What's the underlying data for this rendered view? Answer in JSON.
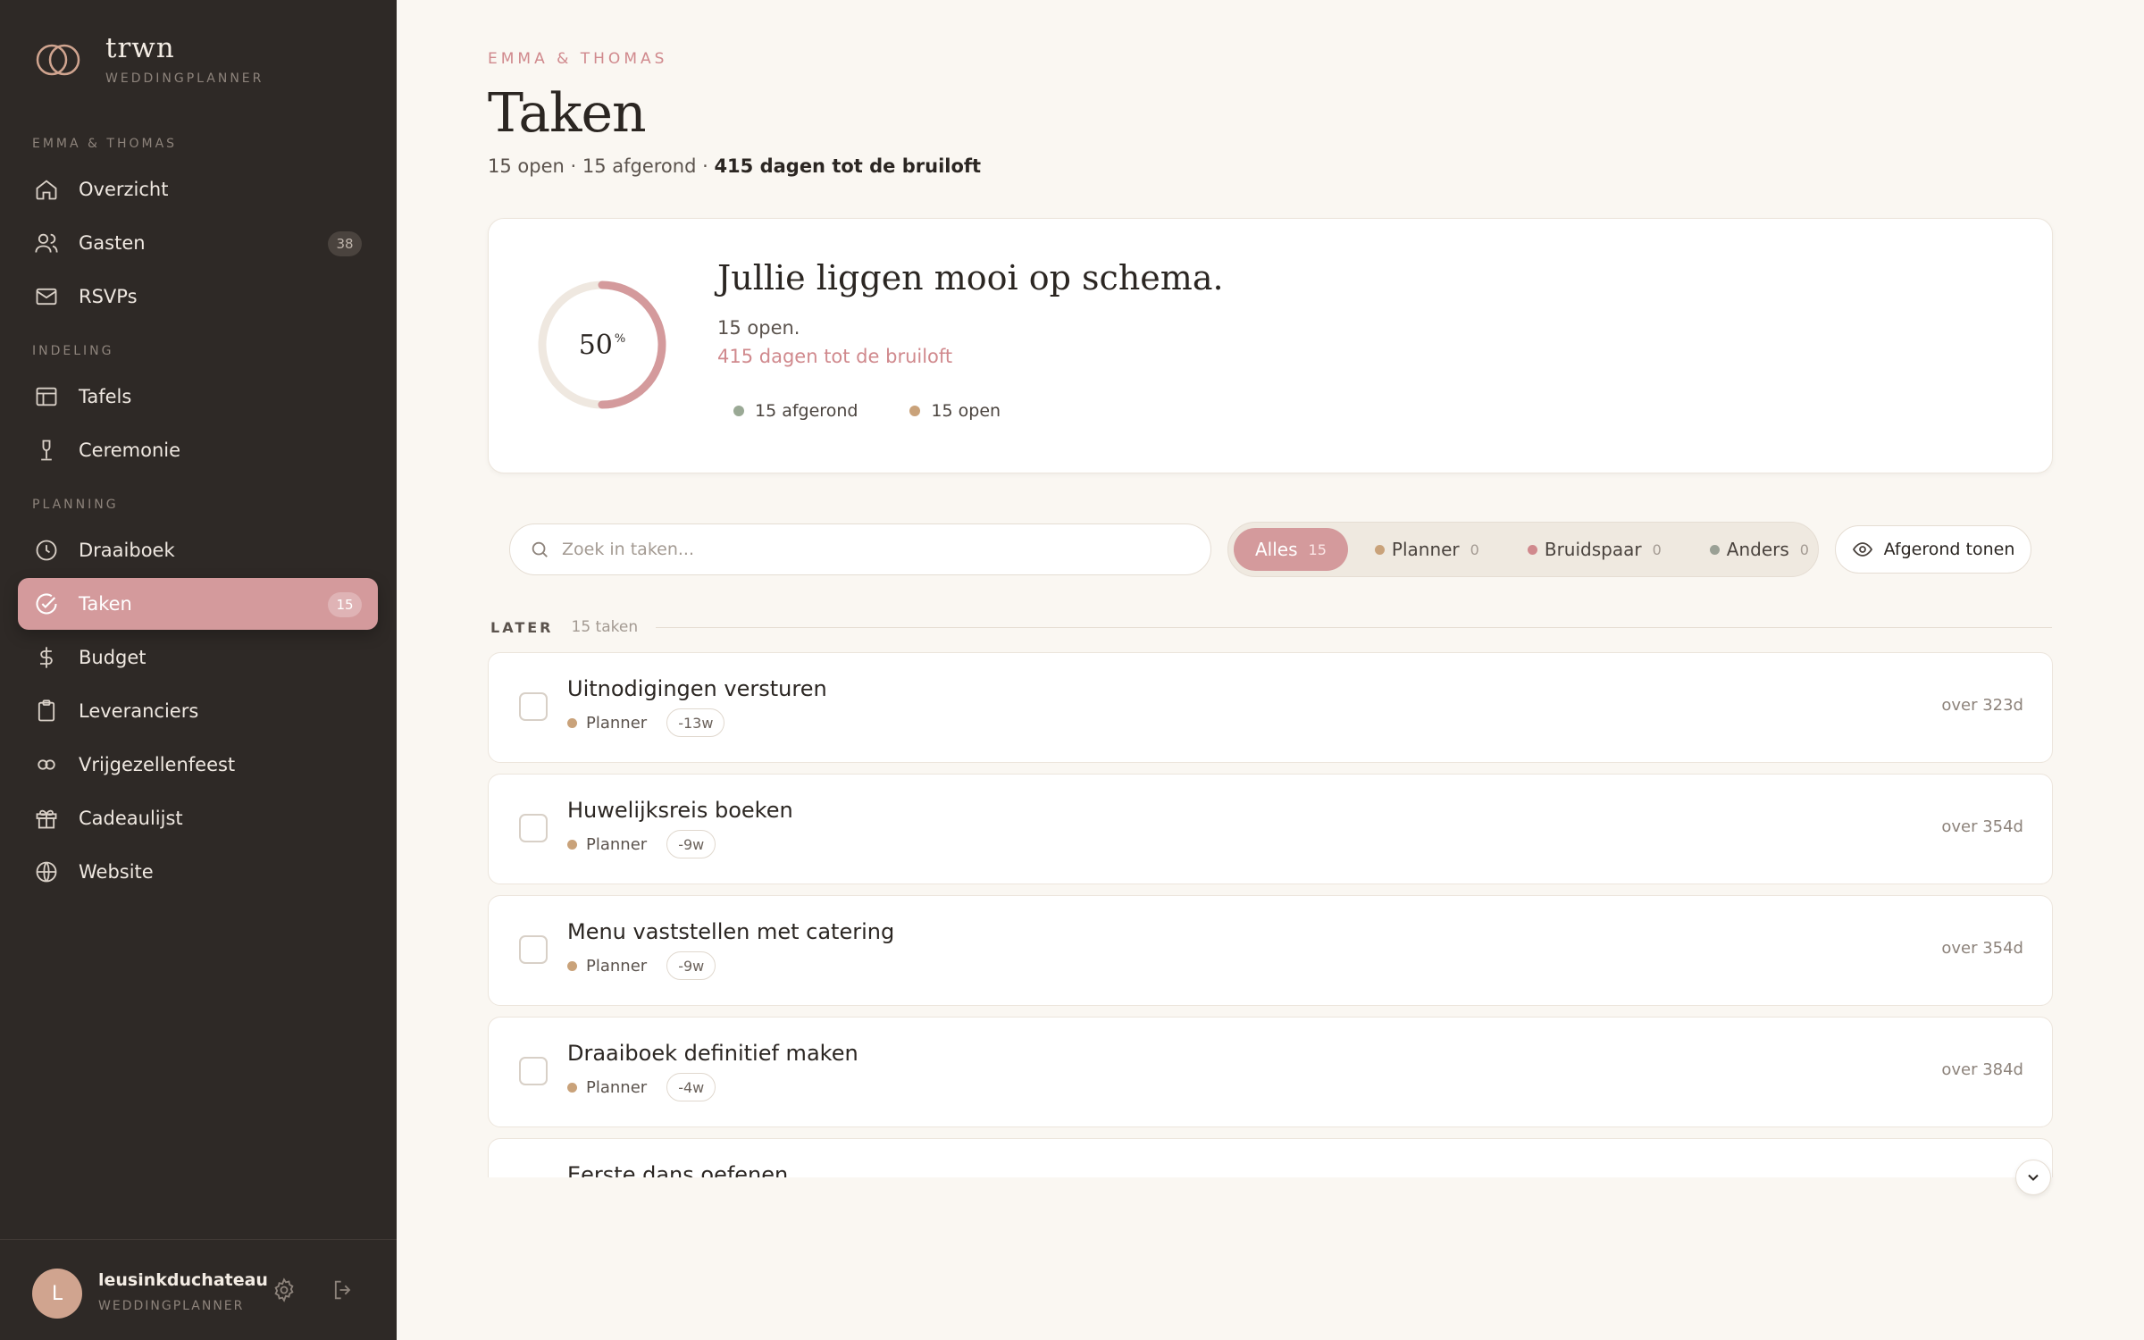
{
  "brand": {
    "name": "trwn",
    "subtitle": "WEDDINGPLANNER"
  },
  "sidebar": {
    "sections": [
      {
        "label": "EMMA & THOMAS"
      },
      {
        "label": "INDELING"
      },
      {
        "label": "PLANNING"
      }
    ],
    "items": [
      {
        "label": "Overzicht",
        "icon": "home-icon"
      },
      {
        "label": "Gasten",
        "icon": "users-icon",
        "badge": "38"
      },
      {
        "label": "RSVPs",
        "icon": "mail-icon"
      },
      {
        "label": "Tafels",
        "icon": "table-icon"
      },
      {
        "label": "Ceremonie",
        "icon": "ceremony-icon"
      },
      {
        "label": "Draaiboek",
        "icon": "clock-icon"
      },
      {
        "label": "Taken",
        "icon": "check-circle-icon",
        "badge": "15",
        "active": true
      },
      {
        "label": "Budget",
        "icon": "dollar-icon"
      },
      {
        "label": "Leveranciers",
        "icon": "clipboard-icon"
      },
      {
        "label": "Vrijgezellenfeest",
        "icon": "rings-icon"
      },
      {
        "label": "Cadeaulijst",
        "icon": "gift-icon"
      },
      {
        "label": "Website",
        "icon": "globe-icon"
      }
    ],
    "user": {
      "initial": "L",
      "name": "leusinkduchateau",
      "role": "WEDDINGPLANNER"
    }
  },
  "header": {
    "eyebrow": "EMMA & THOMAS",
    "title": "Taken",
    "stats_prefix": "15 open · 15 afgerond · ",
    "stats_bold": "415 dagen tot de bruiloft"
  },
  "summary": {
    "percent": "50",
    "percent_unit": "%",
    "progress_fraction": 0.5,
    "headline": "Jullie liggen mooi op schema.",
    "line1": "15 open.",
    "line2": "415 dagen tot de bruiloft",
    "legend": [
      {
        "label": "15 afgerond",
        "color": "#9aa995"
      },
      {
        "label": "15 open",
        "color": "#c9a27a"
      }
    ]
  },
  "toolbar": {
    "search_placeholder": "Zoek in taken...",
    "filters": [
      {
        "label": "Alles",
        "count": "15",
        "active": true
      },
      {
        "label": "Planner",
        "count": "0",
        "color": "#c9a27a"
      },
      {
        "label": "Bruidspaar",
        "count": "0",
        "color": "#d0898d"
      },
      {
        "label": "Anders",
        "count": "0",
        "color": "#9aa095"
      }
    ],
    "show_done_label": "Afgerond tonen"
  },
  "group": {
    "title": "LATER",
    "count": "15 taken"
  },
  "tasks": [
    {
      "title": "Uitnodigingen versturen",
      "owner": "Planner",
      "offset": "-13w",
      "due": "over 323d"
    },
    {
      "title": "Huwelijksreis boeken",
      "owner": "Planner",
      "offset": "-9w",
      "due": "over 354d"
    },
    {
      "title": "Menu vaststellen met catering",
      "owner": "Planner",
      "offset": "-9w",
      "due": "over 354d"
    },
    {
      "title": "Draaiboek definitief maken",
      "owner": "Planner",
      "offset": "-4w",
      "due": "over 384d"
    },
    {
      "title": "Eerste dans oefenen",
      "owner": "",
      "offset": "",
      "due": ""
    }
  ],
  "colors": {
    "accent": "#d49a9c",
    "sidebar": "#2e2926",
    "background": "#faf7f2",
    "planner_dot": "#c9a27a"
  }
}
